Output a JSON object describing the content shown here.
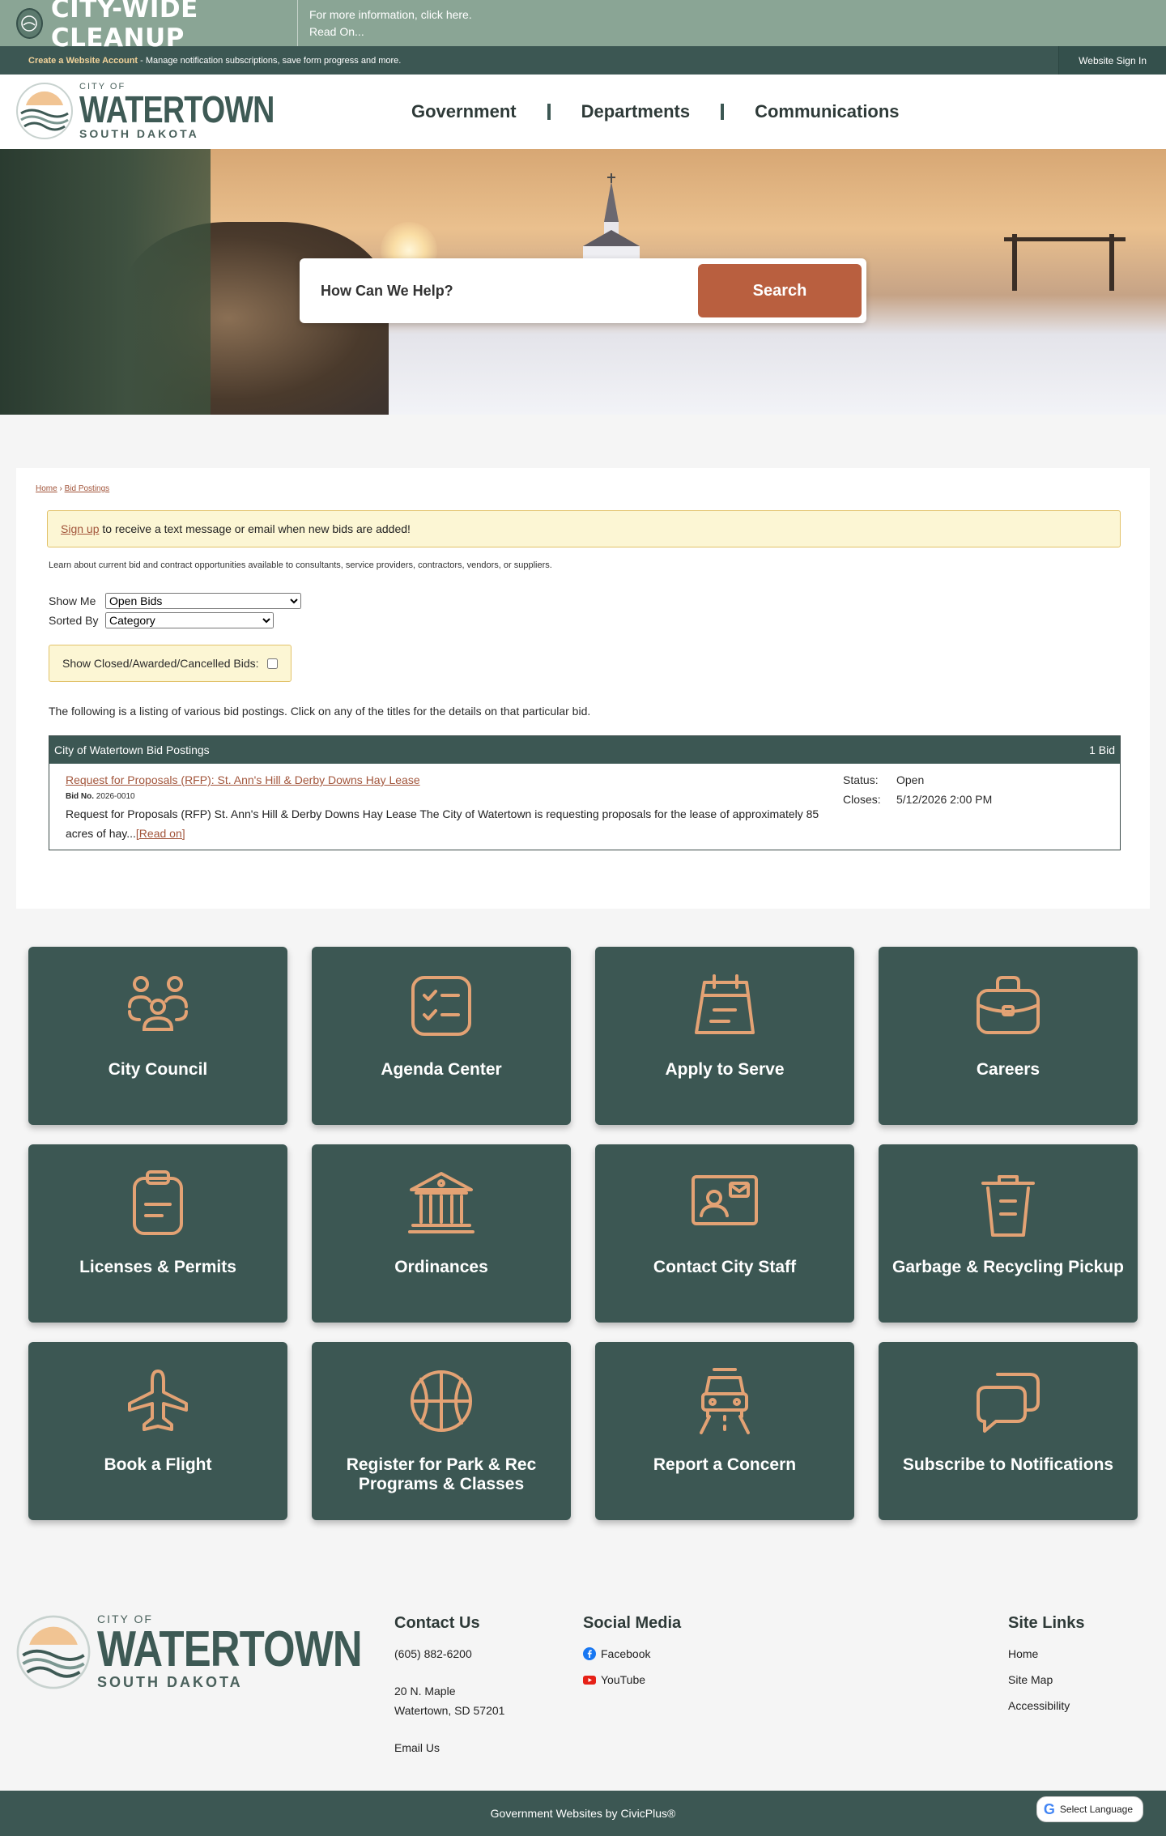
{
  "alert": {
    "title": "CITY-WIDE CLEANUP",
    "line1": "For more information, click here.",
    "line2": "Read On..."
  },
  "account": {
    "create_link": "Create a Website Account",
    "text": " - Manage notification subscriptions, save form progress and more.",
    "signin": "Website Sign In"
  },
  "logo": {
    "small": "CITY OF",
    "big": "WATERTOWN",
    "sub": "SOUTH DAKOTA"
  },
  "nav": {
    "items": [
      {
        "label": "Government"
      },
      {
        "label": "Departments"
      },
      {
        "label": "Communications"
      }
    ]
  },
  "search": {
    "placeholder": "How Can We Help?",
    "button": "Search"
  },
  "breadcrumb": {
    "home": "Home",
    "separator": "›",
    "current": "Bid Postings"
  },
  "notice": {
    "link": "Sign up",
    "text": " to receive a text message or email when new bids are added!"
  },
  "intro": "Learn about current bid and contract opportunities available to consultants, service providers, contractors, vendors, or suppliers.",
  "filters": {
    "show_label": "Show Me",
    "show_value": "Open Bids",
    "sort_label": "Sorted By",
    "sort_value": "Category",
    "closed_label": "Show Closed/Awarded/Cancelled Bids:"
  },
  "listing_note": "The following is a listing of various bid postings. Click on any of the titles for the details on that particular bid.",
  "bids": {
    "header": "City of Watertown Bid Postings",
    "count": "1 Bid",
    "rows": [
      {
        "title": "Request for Proposals (RFP): St. Ann's Hill & Derby Downs Hay Lease",
        "no_label": "Bid No.",
        "no": "2026-0010",
        "desc": "Request for Proposals (RFP) St. Ann's Hill & Derby Downs Hay Lease The City of Watertown is requesting proposals for the lease of approximately 85 acres of hay...",
        "read_on": "[Read on]",
        "status_label": "Status:",
        "status": "Open",
        "closes_label": "Closes:",
        "closes": "5/12/2026 2:00 PM"
      }
    ]
  },
  "tiles": [
    {
      "label": "City Council",
      "icon": "people-icon"
    },
    {
      "label": "Agenda Center",
      "icon": "checklist-icon"
    },
    {
      "label": "Apply to Serve",
      "icon": "calendar-icon"
    },
    {
      "label": "Careers",
      "icon": "briefcase-icon"
    },
    {
      "label": "Licenses & Permits",
      "icon": "clipboard-icon"
    },
    {
      "label": "Ordinances",
      "icon": "building-icon"
    },
    {
      "label": "Contact City Staff",
      "icon": "id-card-icon"
    },
    {
      "label": "Garbage & Recycling Pickup",
      "icon": "trash-icon"
    },
    {
      "label": "Book a Flight",
      "icon": "airplane-icon"
    },
    {
      "label": "Register for Park & Rec Programs & Classes",
      "icon": "basketball-icon"
    },
    {
      "label": "Report a Concern",
      "icon": "car-icon"
    },
    {
      "label": "Subscribe to Notifications",
      "icon": "chat-icon"
    }
  ],
  "footer": {
    "contact": {
      "title": "Contact Us",
      "phone": "(605) 882-6200",
      "address1": "20 N. Maple",
      "address2": "Watertown, SD 57201",
      "email": "Email Us"
    },
    "social": {
      "title": "Social Media",
      "facebook": "Facebook",
      "youtube": "YouTube"
    },
    "links": {
      "title": "Site Links",
      "items": [
        {
          "label": "Home"
        },
        {
          "label": "Site Map"
        },
        {
          "label": "Accessibility"
        }
      ]
    },
    "credit": "Government Websites by CivicPlus®",
    "language": "Select Language"
  },
  "colors": {
    "primary": "#3c5753",
    "accent": "#b95f3f",
    "icon": "#e3a274",
    "alert_bg": "#8aa595",
    "notice_bg": "#fcf6d4"
  }
}
